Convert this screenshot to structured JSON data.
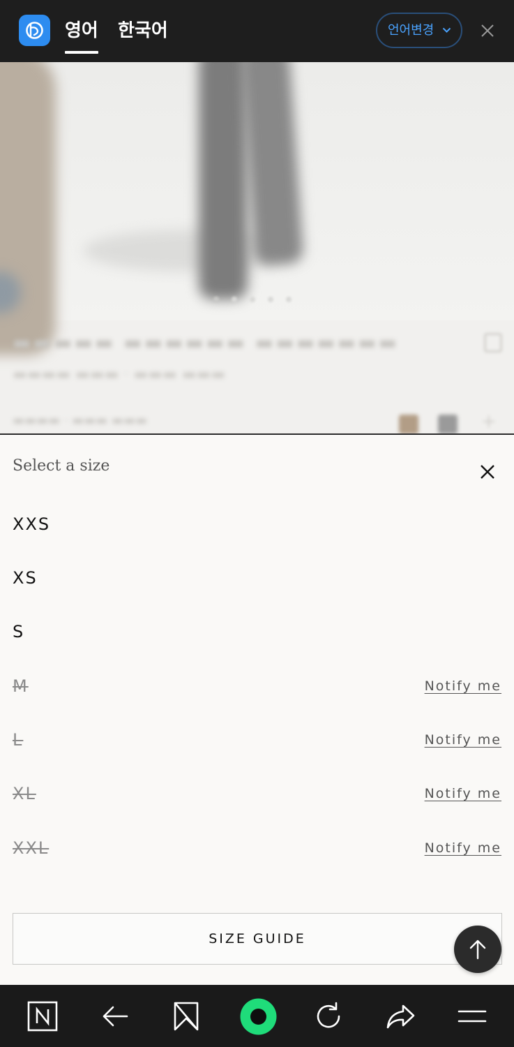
{
  "translate_bar": {
    "tab_english": "영어",
    "tab_korean": "한국어",
    "language_change_label": "언어변경",
    "accent_color": "#4aa3ff",
    "background_color": "#1e1e1e"
  },
  "size_sheet": {
    "title": "Select a size",
    "sizes": [
      {
        "label": "XXS",
        "available": true,
        "notify_label": ""
      },
      {
        "label": "XS",
        "available": true,
        "notify_label": ""
      },
      {
        "label": "S",
        "available": true,
        "notify_label": ""
      },
      {
        "label": "M",
        "available": false,
        "notify_label": "Notify me"
      },
      {
        "label": "L",
        "available": false,
        "notify_label": "Notify me"
      },
      {
        "label": "XL",
        "available": false,
        "notify_label": "Notify me"
      },
      {
        "label": "XXL",
        "available": false,
        "notify_label": "Notify me"
      }
    ],
    "size_guide_label": "SIZE GUIDE"
  },
  "icons": {
    "app": "translate-app-icon",
    "chevron": "chevron-down-icon",
    "close": "close-icon",
    "scroll_top": "arrow-up-icon",
    "bottom_bar": [
      "naver-n-icon",
      "back-arrow-icon",
      "bookmark-icon",
      "home-circle-icon",
      "refresh-icon",
      "share-icon",
      "menu-icon"
    ]
  },
  "colors": {
    "home_button_green": "#1fdc7a",
    "sheet_background": "#faf9f7",
    "unavailable_text": "#8a8a8a"
  }
}
